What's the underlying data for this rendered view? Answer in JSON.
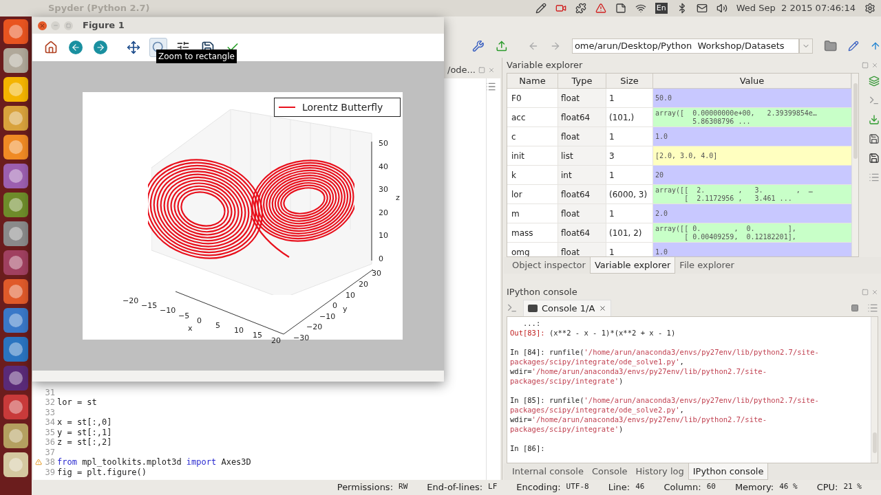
{
  "top_bar": {
    "window_title": "Spyder (Python 2.7)",
    "keyboard": "En",
    "clock": "Wed Sep  2 2015 07:46:14"
  },
  "toolbar": {
    "path": "ome/arun/Desktop/Python  Workshop/Datasets"
  },
  "editor": {
    "tab": "/ode...",
    "lines": [
      {
        "number": "31",
        "warning": false
      },
      {
        "number": "32",
        "warning": false,
        "segments": [
          {
            "kind": "plain",
            "text": "lor = st"
          }
        ]
      },
      {
        "number": "33",
        "warning": false
      },
      {
        "number": "34",
        "warning": false,
        "segments": [
          {
            "kind": "plain",
            "text": "x = st[:,0]"
          }
        ]
      },
      {
        "number": "35",
        "warning": false,
        "segments": [
          {
            "kind": "plain",
            "text": "y = st[:,1]"
          }
        ]
      },
      {
        "number": "36",
        "warning": false,
        "segments": [
          {
            "kind": "plain",
            "text": "z = st[:,2]"
          }
        ]
      },
      {
        "number": "37",
        "warning": false
      },
      {
        "number": "38",
        "warning": true,
        "segments": [
          {
            "kind": "keyword",
            "text": "from"
          },
          {
            "kind": "plain",
            "text": " mpl_toolkits.mplot3d "
          },
          {
            "kind": "keyword",
            "text": "import"
          },
          {
            "kind": "plain",
            "text": " Axes3D"
          }
        ]
      },
      {
        "number": "39",
        "warning": false,
        "segments": [
          {
            "kind": "plain",
            "text": "fig = plt.figure()"
          }
        ]
      }
    ]
  },
  "variable_explorer": {
    "title": "Variable explorer",
    "columns": [
      "Name",
      "Type",
      "Size",
      "Value"
    ],
    "rows": [
      {
        "name": "F0",
        "type": "float",
        "size": "1",
        "value": [
          "50.0"
        ],
        "color": "#c8c8ff"
      },
      {
        "name": "acc",
        "type": "float64",
        "size": "(101,)",
        "value": [
          "array([  0.00000000e+00,   2.39399854e…",
          "         5.86308796 ..."
        ],
        "color": "#c8ffc8"
      },
      {
        "name": "c",
        "type": "float",
        "size": "1",
        "value": [
          "1.0"
        ],
        "color": "#c8c8ff"
      },
      {
        "name": "init",
        "type": "list",
        "size": "3",
        "value": [
          "[2.0, 3.0, 4.0]"
        ],
        "color": "#ffffc0"
      },
      {
        "name": "k",
        "type": "int",
        "size": "1",
        "value": [
          "20"
        ],
        "color": "#c8c8ff"
      },
      {
        "name": "lor",
        "type": "float64",
        "size": "(6000, 3)",
        "value": [
          "array([[  2.        ,   3.        ,  …",
          "       [  2.1172956 ,   3.461 ..."
        ],
        "color": "#c8ffc8"
      },
      {
        "name": "m",
        "type": "float",
        "size": "1",
        "value": [
          "2.0"
        ],
        "color": "#c8c8ff"
      },
      {
        "name": "mass",
        "type": "float64",
        "size": "(101, 2)",
        "value": [
          "array([[ 0.        ,  0.        ],",
          "       [ 0.00409259,  0.12182201],"
        ],
        "color": "#c8ffc8"
      },
      {
        "name": "omg",
        "type": "float",
        "size": "1",
        "value": [
          "1.0"
        ],
        "color": "#c8c8ff"
      }
    ],
    "tabs": [
      {
        "label": "Object inspector",
        "selected": false
      },
      {
        "label": "Variable explorer",
        "selected": true
      },
      {
        "label": "File explorer",
        "selected": false
      }
    ]
  },
  "console": {
    "title": "IPython console",
    "tab": "Console 1/A",
    "blocks": [
      {
        "lines": [
          [
            {
              "kind": "prompt",
              "text": "   ...:"
            }
          ],
          [
            {
              "kind": "out",
              "text": "Out[83]:"
            },
            {
              "kind": "plain",
              "text": " (x**2 - x - 1)*(x**2 + x - 1)"
            }
          ]
        ]
      },
      {
        "lines": [
          [
            {
              "kind": "prompt",
              "text": "In [84]:"
            },
            {
              "kind": "plain",
              "text": " runfile("
            },
            {
              "kind": "string",
              "text": "'/home/arun/anaconda3/envs/py27env/lib/python2.7/site-"
            }
          ],
          [
            {
              "kind": "string",
              "text": "packages/scipy/integrate/ode_solve1.py'"
            },
            {
              "kind": "plain",
              "text": ","
            }
          ],
          [
            {
              "kind": "plain",
              "text": "wdir="
            },
            {
              "kind": "string",
              "text": "'/home/arun/anaconda3/envs/py27env/lib/python2.7/site-"
            }
          ],
          [
            {
              "kind": "string",
              "text": "packages/scipy/integrate'"
            },
            {
              "kind": "plain",
              "text": ")"
            }
          ]
        ]
      },
      {
        "lines": [
          [
            {
              "kind": "prompt",
              "text": "In [85]:"
            },
            {
              "kind": "plain",
              "text": " runfile("
            },
            {
              "kind": "string",
              "text": "'/home/arun/anaconda3/envs/py27env/lib/python2.7/site-"
            }
          ],
          [
            {
              "kind": "string",
              "text": "packages/scipy/integrate/ode_solve2.py'"
            },
            {
              "kind": "plain",
              "text": ","
            }
          ],
          [
            {
              "kind": "plain",
              "text": "wdir="
            },
            {
              "kind": "string",
              "text": "'/home/arun/anaconda3/envs/py27env/lib/python2.7/site-"
            }
          ],
          [
            {
              "kind": "string",
              "text": "packages/scipy/integrate'"
            },
            {
              "kind": "plain",
              "text": ")"
            }
          ]
        ]
      },
      {
        "lines": [
          [
            {
              "kind": "prompt",
              "text": "In [86]:"
            }
          ]
        ]
      }
    ],
    "tabs": [
      {
        "label": "Internal console",
        "selected": false
      },
      {
        "label": "Console",
        "selected": false
      },
      {
        "label": "History log",
        "selected": false
      },
      {
        "label": "IPython console",
        "selected": true
      }
    ]
  },
  "status_bar": [
    {
      "label": "Permissions:",
      "value": "RW"
    },
    {
      "label": "End-of-lines:",
      "value": "LF"
    },
    {
      "label": "Encoding:",
      "value": "UTF-8"
    },
    {
      "label": "Line:",
      "value": "46"
    },
    {
      "label": "Column:",
      "value": "60"
    },
    {
      "label": "Memory:",
      "value": "46 %"
    },
    {
      "label": "CPU:",
      "value": "21 %"
    }
  ],
  "figure": {
    "title": "Figure 1",
    "tooltip": "Zoom to rectangle",
    "tools": [
      {
        "kind": "home",
        "selected": false
      },
      {
        "kind": "back",
        "selected": false
      },
      {
        "kind": "forward",
        "selected": false
      },
      {
        "kind": "pan",
        "selected": false
      },
      {
        "kind": "zoom",
        "selected": true
      },
      {
        "kind": "configure",
        "selected": false
      },
      {
        "kind": "save",
        "selected": false
      },
      {
        "kind": "edit",
        "selected": false
      }
    ],
    "plot": {
      "legend": "Lorentz Butterfly",
      "x_label": "x",
      "y_label": "y",
      "z_label": "z",
      "x_ticks": [
        "−20",
        "−15",
        "−10",
        "−5",
        "0",
        "5",
        "10",
        "15",
        "20"
      ],
      "y_ticks": [
        "−30",
        "−20",
        "−10",
        "0",
        "10",
        "20",
        "30"
      ],
      "z_ticks": [
        "50",
        "40",
        "30",
        "20",
        "10",
        "0"
      ]
    }
  }
}
